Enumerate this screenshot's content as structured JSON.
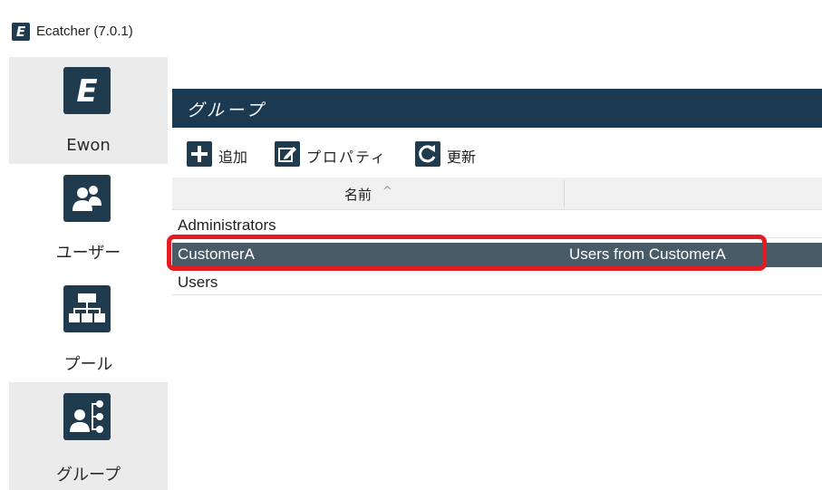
{
  "window": {
    "title": "Ecatcher (7.0.1)",
    "app_icon_letter": "E"
  },
  "sidebar": {
    "items": [
      {
        "id": "ewon",
        "label": "Ewon",
        "icon": "ewon-logo-icon",
        "glyph": "E",
        "active": true
      },
      {
        "id": "users",
        "label": "ユーザー",
        "icon": "users-icon",
        "active": false
      },
      {
        "id": "pools",
        "label": "プール",
        "icon": "hierarchy-icon",
        "active": false
      },
      {
        "id": "groups",
        "label": "グループ",
        "icon": "group-hierarchy-icon",
        "active": true
      }
    ]
  },
  "main": {
    "header": {
      "title": "グループ"
    },
    "toolbar": {
      "add_label": "追加",
      "properties_label": "プロパティ",
      "refresh_label": "更新"
    },
    "table": {
      "columns": [
        {
          "label": "名前",
          "sort": "ascending",
          "sort_glyph": "^"
        },
        {
          "label": ""
        }
      ],
      "rows": [
        {
          "name": "Administrators",
          "description": "",
          "selected": false
        },
        {
          "name": "CustomerA",
          "description": "Users from CustomerA",
          "selected": true
        },
        {
          "name": "Users",
          "description": "",
          "selected": false
        }
      ]
    }
  },
  "colors": {
    "header_bar": "#1b3a52",
    "icon_tile": "#1f3b4d",
    "selected_row": "#495b67",
    "highlight_border": "#e41b23",
    "active_nav": "#ebebeb"
  }
}
